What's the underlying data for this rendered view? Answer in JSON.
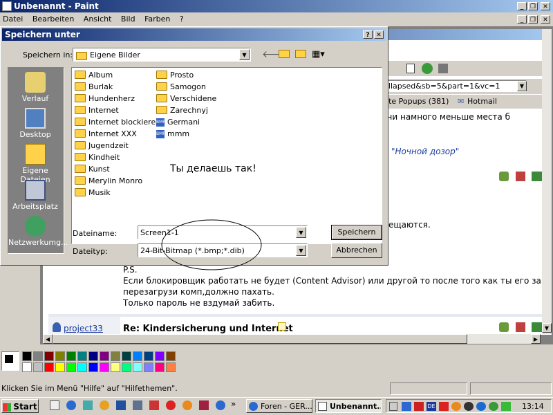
{
  "app": {
    "title": "Unbenannt - Paint",
    "menu": [
      "Datei",
      "Bearbeiten",
      "Ansicht",
      "Bild",
      "Farben",
      "?"
    ]
  },
  "browser": {
    "url_fragment": "0&view=collapsed&sb=5&part=1&vc=1",
    "links": [
      "Blockierte Popups (381)",
      "Hotmail"
    ],
    "text_top": "а в .jpg. Они намного меньше места б",
    "quote_link": "\"Ночной дозор\"",
    "text_mid": "ещаются.",
    "post_lines": [
      "P.S.",
      "Если блокировщик работать не будет (Content Advisor) или другой то после того как ты его запароли",
      "перезагрузи комп,должно пахать.",
      "Только пароль не вздумай забить."
    ],
    "author": "project33",
    "reply_title": "Re: Kindersicherung und Internet"
  },
  "dialog": {
    "title": "Speichern unter",
    "save_in_label": "Speichern in:",
    "save_in_value": "Eigene Bilder",
    "places": [
      "Verlauf",
      "Desktop",
      "Eigene Dateien",
      "Arbeitsplatz",
      "Netzwerkumg..."
    ],
    "files_col1": [
      "Album",
      "Burlak",
      "Hundenherz",
      "Internet",
      "Internet blockieren",
      "Internet XXX",
      "Jugendzeit",
      "Kindheit",
      "Kunst",
      "Merylin Monro",
      "Musik"
    ],
    "files_col2": [
      "Prosto",
      "Samogon",
      "Verschidene",
      "Zarechnyj"
    ],
    "files_col2_bmp": [
      "Germani",
      "mmm"
    ],
    "annotation": "Ты делаешь так!",
    "filename_label": "Dateiname:",
    "filename_value": "Screen1-1",
    "filetype_label": "Dateityp:",
    "filetype_value": "24-Bit-Bitmap (*.bmp;*.dib)",
    "save_button": "Speichern",
    "cancel_button": "Abbrechen"
  },
  "statusbar": {
    "text": "Klicken Sie im Menü \"Hilfe\" auf \"Hilfethemen\"."
  },
  "palette_top": [
    "#000000",
    "#808080",
    "#800000",
    "#808000",
    "#008000",
    "#008080",
    "#000080",
    "#800080",
    "#808040",
    "#004040",
    "#0080ff",
    "#004080",
    "#8000ff",
    "#804000"
  ],
  "palette_bottom": [
    "#ffffff",
    "#c0c0c0",
    "#ff0000",
    "#ffff00",
    "#00ff00",
    "#00ffff",
    "#0000ff",
    "#ff00ff",
    "#ffff80",
    "#00ff80",
    "#80ffff",
    "#8080ff",
    "#ff0080",
    "#ff8040"
  ],
  "taskbar": {
    "start": "Start",
    "tasks": [
      "Foren - GER...",
      "Unbenannt..."
    ],
    "clock": "13:14"
  }
}
